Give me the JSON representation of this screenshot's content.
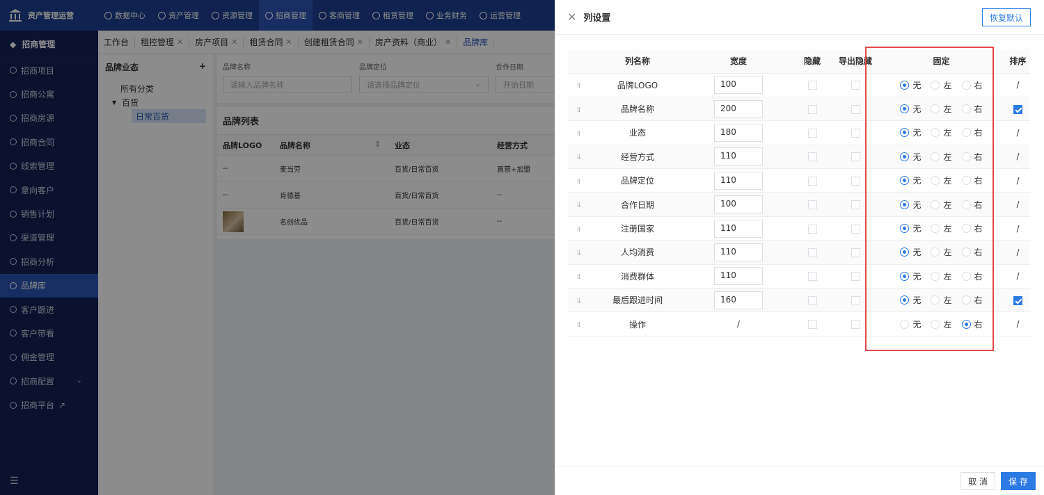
{
  "app": {
    "brand": "资产管理运营"
  },
  "topnav": [
    {
      "label": "数据中心"
    },
    {
      "label": "资产管理"
    },
    {
      "label": "资源管理"
    },
    {
      "label": "招商管理",
      "active": true
    },
    {
      "label": "客商管理"
    },
    {
      "label": "租赁管理"
    },
    {
      "label": "业务财务"
    },
    {
      "label": "运营管理"
    }
  ],
  "sidebar": {
    "header": "招商管理",
    "items": [
      {
        "label": "招商项目"
      },
      {
        "label": "招商公寓"
      },
      {
        "label": "招商房源"
      },
      {
        "label": "招商合同"
      },
      {
        "label": "线索管理"
      },
      {
        "label": "意向客户"
      },
      {
        "label": "销售计划"
      },
      {
        "label": "渠道管理"
      },
      {
        "label": "招商分析"
      },
      {
        "label": "品牌库",
        "active": true
      },
      {
        "label": "客户跟进"
      },
      {
        "label": "客户带看"
      },
      {
        "label": "佣金管理"
      },
      {
        "label": "招商配置"
      },
      {
        "label": "招商平台"
      }
    ],
    "bottom_icon": "☰"
  },
  "tabs": [
    {
      "label": "工作台"
    },
    {
      "label": "租控管理"
    },
    {
      "label": "房产项目"
    },
    {
      "label": "租赁合同"
    },
    {
      "label": "创建租赁合同"
    },
    {
      "label": "房产资料（商业）"
    },
    {
      "label": "品牌库"
    }
  ],
  "filterpane": {
    "title": "品牌业态",
    "add": "+",
    "nodes": [
      "所有分类",
      "百货",
      "日常百货"
    ]
  },
  "filters": {
    "brand_name_label": "品牌名称",
    "brand_name_placeholder": "请输入品牌名称",
    "position_label": "品牌定位",
    "position_placeholder": "请选择品牌定位",
    "date_label": "合作日期",
    "date_placeholder": "开始日期"
  },
  "brand_list": {
    "title": "品牌列表",
    "headers": [
      "品牌LOGO",
      "品牌名称",
      "业态",
      "经营方式"
    ],
    "rows": [
      {
        "logo": "--",
        "name": "麦当劳",
        "format": "百货/日常百货",
        "mode": "直营+加盟"
      },
      {
        "logo": "--",
        "name": "肯德基",
        "format": "百货/日常百货",
        "mode": "--"
      },
      {
        "logo": "",
        "name": "名创优品",
        "format": "百货/日常百货",
        "mode": "--"
      }
    ]
  },
  "drawer": {
    "title": "列设置",
    "reset_label": "恢复默认",
    "headers": {
      "name": "列名称",
      "width": "宽度",
      "hidden": "隐藏",
      "export_hidden": "导出隐藏",
      "fixed": "固定",
      "sort": "排序"
    },
    "fixed_options": [
      "无",
      "左",
      "右"
    ],
    "rows": [
      {
        "name": "品牌LOGO",
        "width": "100",
        "fixed": "无",
        "sort": "/"
      },
      {
        "name": "品牌名称",
        "width": "200",
        "fixed": "无",
        "sort": "check"
      },
      {
        "name": "业态",
        "width": "180",
        "fixed": "无",
        "sort": "/"
      },
      {
        "name": "经营方式",
        "width": "110",
        "fixed": "无",
        "sort": "/"
      },
      {
        "name": "品牌定位",
        "width": "110",
        "fixed": "无",
        "sort": "/"
      },
      {
        "name": "合作日期",
        "width": "100",
        "fixed": "无",
        "sort": "/"
      },
      {
        "name": "注册国家",
        "width": "110",
        "fixed": "无",
        "sort": "/"
      },
      {
        "name": "人均消费",
        "width": "110",
        "fixed": "无",
        "sort": "/"
      },
      {
        "name": "消费群体",
        "width": "110",
        "fixed": "无",
        "sort": "/"
      },
      {
        "name": "最后跟进时间",
        "width": "160",
        "fixed": "无",
        "sort": "check"
      },
      {
        "name": "操作",
        "width": "/",
        "fixed": "右",
        "sort": "/"
      }
    ],
    "cancel_label": "取 消",
    "save_label": "保 存"
  },
  "colors": {
    "accent": "#2c7be5",
    "topbar": "#1e3e91",
    "sidebar": "#132157",
    "highlight": "#e24a4a"
  }
}
